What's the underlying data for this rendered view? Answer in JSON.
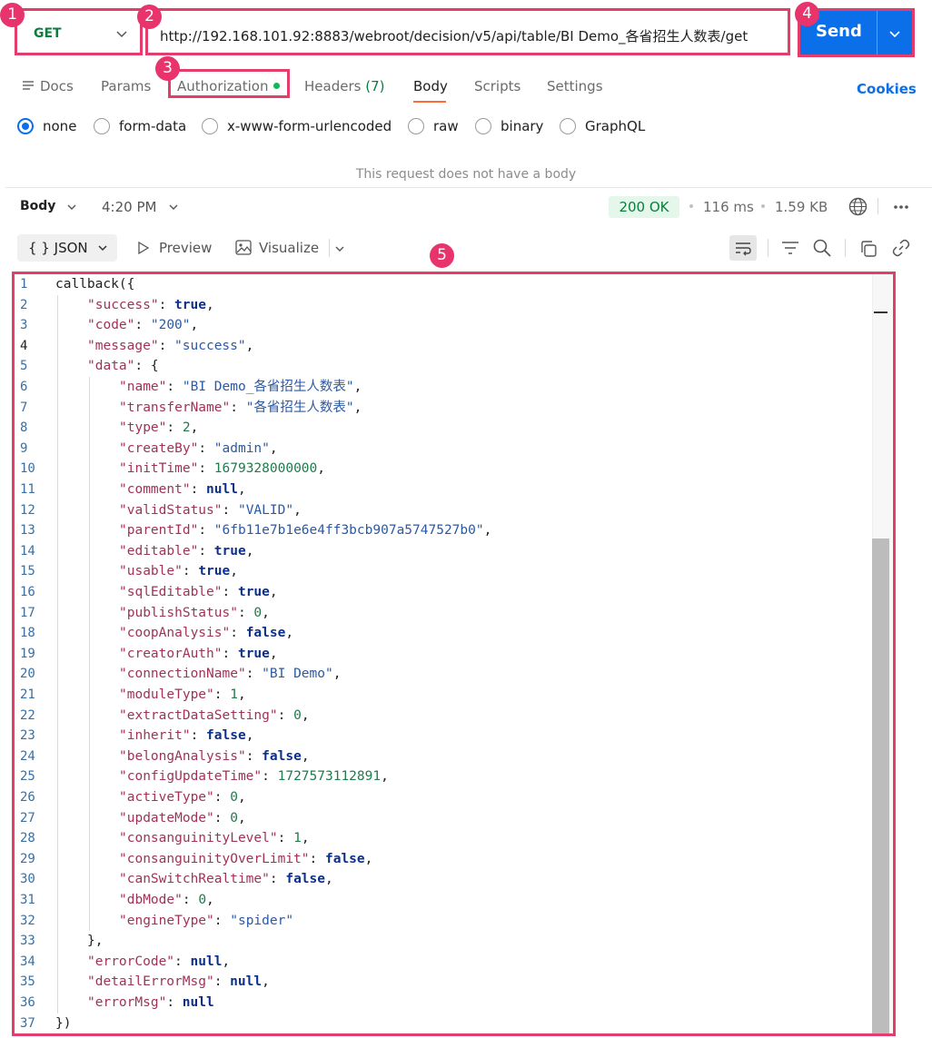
{
  "request": {
    "method": "GET",
    "url": "http://192.168.101.92:8883/webroot/decision/v5/api/table/BI Demo_各省招生人数表/get",
    "send_label": "Send"
  },
  "badges": [
    "1",
    "2",
    "3",
    "4",
    "5"
  ],
  "tabs": {
    "docs": "Docs",
    "params": "Params",
    "authorization": "Authorization",
    "headers": "Headers",
    "headers_count": "(7)",
    "body": "Body",
    "scripts": "Scripts",
    "settings": "Settings",
    "cookies": "Cookies"
  },
  "body_types": [
    "none",
    "form-data",
    "x-www-form-urlencoded",
    "raw",
    "binary",
    "GraphQL"
  ],
  "body_selected": "none",
  "no_body_text": "This request does not have a body",
  "response": {
    "section_label": "Body",
    "time": "4:20 PM",
    "status": "200 OK",
    "duration": "116 ms",
    "size": "1.59 KB",
    "format": "JSON",
    "preview": "Preview",
    "visualize": "Visualize"
  },
  "colors": {
    "accent": "#0c6fea",
    "highlight": "#e33d6b",
    "ok_green": "#0a7e3d",
    "tab_indicator": "#ff6c37"
  },
  "code_lines": [
    {
      "indent": 0,
      "text": "callback({"
    },
    {
      "indent": 1,
      "key": "success",
      "value": "true",
      "type": "b",
      "comma": true
    },
    {
      "indent": 1,
      "key": "code",
      "value": "\"200\"",
      "type": "s",
      "comma": true
    },
    {
      "indent": 1,
      "key": "message",
      "value": "\"success\"",
      "type": "s",
      "comma": true
    },
    {
      "indent": 1,
      "key": "data",
      "value": "{",
      "type": "p",
      "comma": false
    },
    {
      "indent": 2,
      "key": "name",
      "value": "\"BI Demo_各省招生人数表\"",
      "type": "s",
      "comma": true
    },
    {
      "indent": 2,
      "key": "transferName",
      "value": "\"各省招生人数表\"",
      "type": "s",
      "comma": true
    },
    {
      "indent": 2,
      "key": "type",
      "value": "2",
      "type": "n",
      "comma": true
    },
    {
      "indent": 2,
      "key": "createBy",
      "value": "\"admin\"",
      "type": "s",
      "comma": true
    },
    {
      "indent": 2,
      "key": "initTime",
      "value": "1679328000000",
      "type": "n",
      "comma": true
    },
    {
      "indent": 2,
      "key": "comment",
      "value": "null",
      "type": "b",
      "comma": true
    },
    {
      "indent": 2,
      "key": "validStatus",
      "value": "\"VALID\"",
      "type": "s",
      "comma": true
    },
    {
      "indent": 2,
      "key": "parentId",
      "value": "\"6fb11e7b1e6e4ff3bcb907a5747527b0\"",
      "type": "s",
      "comma": true
    },
    {
      "indent": 2,
      "key": "editable",
      "value": "true",
      "type": "b",
      "comma": true
    },
    {
      "indent": 2,
      "key": "usable",
      "value": "true",
      "type": "b",
      "comma": true
    },
    {
      "indent": 2,
      "key": "sqlEditable",
      "value": "true",
      "type": "b",
      "comma": true
    },
    {
      "indent": 2,
      "key": "publishStatus",
      "value": "0",
      "type": "n",
      "comma": true
    },
    {
      "indent": 2,
      "key": "coopAnalysis",
      "value": "false",
      "type": "b",
      "comma": true
    },
    {
      "indent": 2,
      "key": "creatorAuth",
      "value": "true",
      "type": "b",
      "comma": true
    },
    {
      "indent": 2,
      "key": "connectionName",
      "value": "\"BI Demo\"",
      "type": "s",
      "comma": true
    },
    {
      "indent": 2,
      "key": "moduleType",
      "value": "1",
      "type": "n",
      "comma": true
    },
    {
      "indent": 2,
      "key": "extractDataSetting",
      "value": "0",
      "type": "n",
      "comma": true
    },
    {
      "indent": 2,
      "key": "inherit",
      "value": "false",
      "type": "b",
      "comma": true
    },
    {
      "indent": 2,
      "key": "belongAnalysis",
      "value": "false",
      "type": "b",
      "comma": true
    },
    {
      "indent": 2,
      "key": "configUpdateTime",
      "value": "1727573112891",
      "type": "n",
      "comma": true
    },
    {
      "indent": 2,
      "key": "activeType",
      "value": "0",
      "type": "n",
      "comma": true
    },
    {
      "indent": 2,
      "key": "updateMode",
      "value": "0",
      "type": "n",
      "comma": true
    },
    {
      "indent": 2,
      "key": "consanguinityLevel",
      "value": "1",
      "type": "n",
      "comma": true
    },
    {
      "indent": 2,
      "key": "consanguinityOverLimit",
      "value": "false",
      "type": "b",
      "comma": true
    },
    {
      "indent": 2,
      "key": "canSwitchRealtime",
      "value": "false",
      "type": "b",
      "comma": true
    },
    {
      "indent": 2,
      "key": "dbMode",
      "value": "0",
      "type": "n",
      "comma": true
    },
    {
      "indent": 2,
      "key": "engineType",
      "value": "\"spider\"",
      "type": "s",
      "comma": false
    },
    {
      "indent": 1,
      "text": "},"
    },
    {
      "indent": 1,
      "key": "errorCode",
      "value": "null",
      "type": "b",
      "comma": true
    },
    {
      "indent": 1,
      "key": "detailErrorMsg",
      "value": "null",
      "type": "b",
      "comma": true
    },
    {
      "indent": 1,
      "key": "errorMsg",
      "value": "null",
      "type": "b",
      "comma": false
    },
    {
      "indent": 0,
      "text": "})"
    }
  ],
  "current_line": 4
}
